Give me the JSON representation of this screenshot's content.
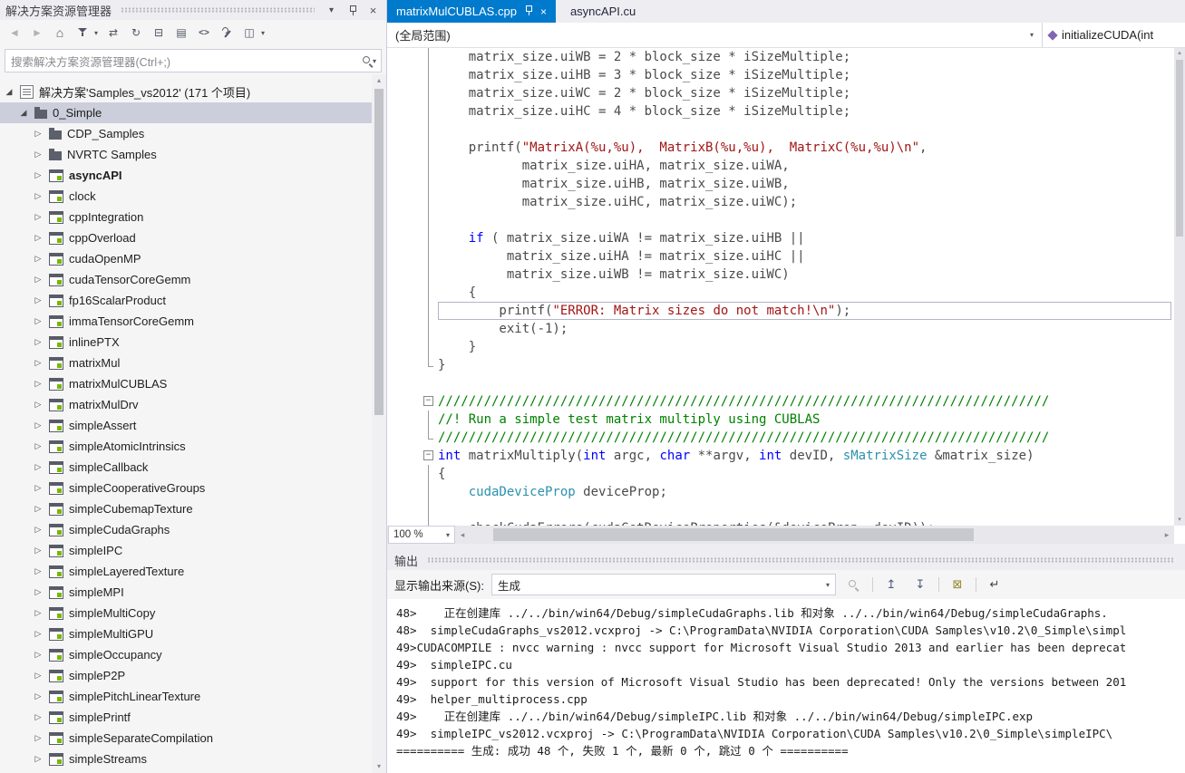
{
  "colors": {
    "accent": "#007acc",
    "selection": "#cccedb",
    "keyword": "#0000ff",
    "string": "#a31515",
    "comment": "#008000",
    "type": "#2b91af",
    "nvidia_green": "#76b900"
  },
  "icons": {
    "caret": "▾",
    "close": "×",
    "back": "◄",
    "forward": "►",
    "home": "⌂",
    "sync": "⇄",
    "refresh": "↻",
    "collapse_all": "⊟",
    "show_all": "▤",
    "view_code": "<>",
    "preview": "◫",
    "scroll_left": "◂",
    "scroll_right": "▸",
    "scroll_up": "▴",
    "scroll_down": "▾",
    "prev_msg": "↥",
    "next_msg": "↧",
    "clear_all": "⊠",
    "word_wrap": "↵",
    "expanded": "◢",
    "collapsed": "▷",
    "minus": "−"
  },
  "solution_explorer": {
    "title": "解决方案资源管理器",
    "search_placeholder": "搜索解决方案资源管理器(Ctrl+;)",
    "solution_label": "解决方案'Samples_vs2012' (171 个项目)",
    "root_label": "0_Simple",
    "items": [
      {
        "label": "CDP_Samples",
        "kind": "folder"
      },
      {
        "label": "NVRTC Samples",
        "kind": "folder"
      },
      {
        "label": "asyncAPI",
        "kind": "project",
        "bold": true
      },
      {
        "label": "clock",
        "kind": "project"
      },
      {
        "label": "cppIntegration",
        "kind": "project"
      },
      {
        "label": "cppOverload",
        "kind": "project"
      },
      {
        "label": "cudaOpenMP",
        "kind": "project"
      },
      {
        "label": "cudaTensorCoreGemm",
        "kind": "project"
      },
      {
        "label": "fp16ScalarProduct",
        "kind": "project"
      },
      {
        "label": "immaTensorCoreGemm",
        "kind": "project"
      },
      {
        "label": "inlinePTX",
        "kind": "project"
      },
      {
        "label": "matrixMul",
        "kind": "project"
      },
      {
        "label": "matrixMulCUBLAS",
        "kind": "project"
      },
      {
        "label": "matrixMulDrv",
        "kind": "project"
      },
      {
        "label": "simpleAssert",
        "kind": "project"
      },
      {
        "label": "simpleAtomicIntrinsics",
        "kind": "project"
      },
      {
        "label": "simpleCallback",
        "kind": "project"
      },
      {
        "label": "simpleCooperativeGroups",
        "kind": "project"
      },
      {
        "label": "simpleCubemapTexture",
        "kind": "project"
      },
      {
        "label": "simpleCudaGraphs",
        "kind": "project"
      },
      {
        "label": "simpleIPC",
        "kind": "project"
      },
      {
        "label": "simpleLayeredTexture",
        "kind": "project"
      },
      {
        "label": "simpleMPI",
        "kind": "project"
      },
      {
        "label": "simpleMultiCopy",
        "kind": "project"
      },
      {
        "label": "simpleMultiGPU",
        "kind": "project"
      },
      {
        "label": "simpleOccupancy",
        "kind": "project"
      },
      {
        "label": "simpleP2P",
        "kind": "project"
      },
      {
        "label": "simplePitchLinearTexture",
        "kind": "project"
      },
      {
        "label": "simplePrintf",
        "kind": "project"
      },
      {
        "label": "simpleSeparateCompilation",
        "kind": "project"
      },
      {
        "label": "simpleStreams",
        "kind": "project"
      }
    ]
  },
  "editor": {
    "tabs": [
      {
        "label": "matrixMulCUBLAS.cpp",
        "active": true
      },
      {
        "label": "asyncAPI.cu",
        "active": false
      }
    ],
    "scope": "(全局范围)",
    "member": "initializeCUDA(int",
    "zoom": "100 %",
    "code": {
      "lines": [
        {
          "g": "v",
          "s": [
            [
              "p",
              "    matrix_size.uiWB = 2 * block_size * iSizeMultiple;"
            ]
          ]
        },
        {
          "g": "v",
          "s": [
            [
              "p",
              "    matrix_size.uiHB = 3 * block_size * iSizeMultiple;"
            ]
          ]
        },
        {
          "g": "v",
          "s": [
            [
              "p",
              "    matrix_size.uiWC = 2 * block_size * iSizeMultiple;"
            ]
          ]
        },
        {
          "g": "v",
          "s": [
            [
              "p",
              "    matrix_size.uiHC = 4 * block_size * iSizeMultiple;"
            ]
          ]
        },
        {
          "g": "v",
          "s": []
        },
        {
          "g": "v",
          "s": [
            [
              "p",
              "    printf("
            ],
            [
              "s",
              "\"MatrixA(%u,%u),  MatrixB(%u,%u),  MatrixC(%u,%u)\\n\""
            ],
            [
              "p",
              ","
            ]
          ]
        },
        {
          "g": "v",
          "s": [
            [
              "p",
              "           matrix_size.uiHA, matrix_size.uiWA,"
            ]
          ]
        },
        {
          "g": "v",
          "s": [
            [
              "p",
              "           matrix_size.uiHB, matrix_size.uiWB,"
            ]
          ]
        },
        {
          "g": "v",
          "s": [
            [
              "p",
              "           matrix_size.uiHC, matrix_size.uiWC);"
            ]
          ]
        },
        {
          "g": "v",
          "s": []
        },
        {
          "g": "v",
          "s": [
            [
              "p",
              "    "
            ],
            [
              "k",
              "if"
            ],
            [
              "p",
              " ( matrix_size.uiWA != matrix_size.uiHB ||"
            ]
          ]
        },
        {
          "g": "v",
          "s": [
            [
              "p",
              "         matrix_size.uiHA != matrix_size.uiHC ||"
            ]
          ]
        },
        {
          "g": "v",
          "s": [
            [
              "p",
              "         matrix_size.uiWB != matrix_size.uiWC)"
            ]
          ]
        },
        {
          "g": "v",
          "s": [
            [
              "p",
              "    {"
            ]
          ]
        },
        {
          "g": "v",
          "cur": true,
          "s": [
            [
              "p",
              "        printf("
            ],
            [
              "s",
              "\"ERROR: Matrix sizes do not match!\\n\""
            ],
            [
              "p",
              ");"
            ]
          ]
        },
        {
          "g": "v",
          "s": [
            [
              "p",
              "        exit(-1);"
            ]
          ]
        },
        {
          "g": "v",
          "s": [
            [
              "p",
              "    }"
            ]
          ]
        },
        {
          "g": "e",
          "s": [
            [
              "p",
              "}"
            ]
          ]
        },
        {
          "g": "",
          "s": []
        },
        {
          "g": "b",
          "s": [
            [
              "c",
              "////////////////////////////////////////////////////////////////////////////////"
            ]
          ]
        },
        {
          "g": "v",
          "s": [
            [
              "c",
              "//! Run a simple test matrix multiply using CUBLAS"
            ]
          ]
        },
        {
          "g": "e",
          "s": [
            [
              "c",
              "////////////////////////////////////////////////////////////////////////////////"
            ]
          ]
        },
        {
          "g": "b",
          "s": [
            [
              "k",
              "int"
            ],
            [
              "p",
              " matrixMultiply("
            ],
            [
              "k",
              "int"
            ],
            [
              "p",
              " argc, "
            ],
            [
              "k",
              "char"
            ],
            [
              "p",
              " **argv, "
            ],
            [
              "k",
              "int"
            ],
            [
              "p",
              " devID, "
            ],
            [
              "t",
              "sMatrixSize"
            ],
            [
              "p",
              " &matrix_size)"
            ]
          ]
        },
        {
          "g": "v",
          "s": [
            [
              "p",
              "{"
            ]
          ]
        },
        {
          "g": "v",
          "s": [
            [
              "p",
              "    "
            ],
            [
              "t",
              "cudaDeviceProp"
            ],
            [
              "p",
              " deviceProp;"
            ]
          ]
        },
        {
          "g": "v",
          "s": []
        },
        {
          "g": "v",
          "s": [
            [
              "p",
              "    checkCudaErrors(cudaGetDeviceProperties(&deviceProp, devID));"
            ]
          ]
        }
      ]
    }
  },
  "output": {
    "title": "输出",
    "source_label": "显示输出来源(S):",
    "source_value": "生成",
    "lines": [
      "48>    正在创建库 ../../bin/win64/Debug/simpleCudaGraphs.lib 和对象 ../../bin/win64/Debug/simpleCudaGraphs.",
      "48>  simpleCudaGraphs_vs2012.vcxproj -> C:\\ProgramData\\NVIDIA Corporation\\CUDA Samples\\v10.2\\0_Simple\\simpl",
      "49>CUDACOMPILE : nvcc warning : nvcc support for Microsoft Visual Studio 2013 and earlier has been deprecat",
      "49>  simpleIPC.cu",
      "49>  support for this version of Microsoft Visual Studio has been deprecated! Only the versions between 201",
      "49>  helper_multiprocess.cpp",
      "49>    正在创建库 ../../bin/win64/Debug/simpleIPC.lib 和对象 ../../bin/win64/Debug/simpleIPC.exp",
      "49>  simpleIPC_vs2012.vcxproj -> C:\\ProgramData\\NVIDIA Corporation\\CUDA Samples\\v10.2\\0_Simple\\simpleIPC\\",
      "========== 生成: 成功 48 个, 失败 1 个, 最新 0 个, 跳过 0 个 =========="
    ]
  }
}
